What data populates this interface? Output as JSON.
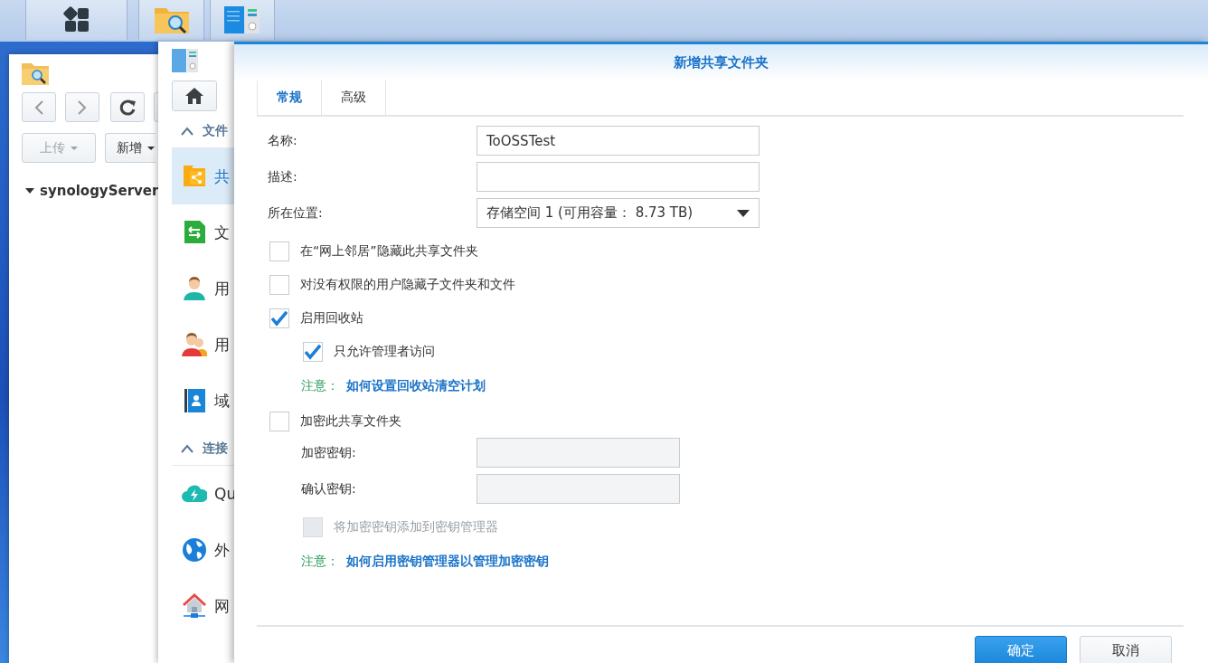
{
  "taskbar": {
    "buttons": [
      {
        "kind": "main-menu"
      },
      {
        "kind": "file-station"
      },
      {
        "kind": "control-panel"
      }
    ]
  },
  "file_station": {
    "nav": [
      {
        "kind": "back"
      },
      {
        "kind": "forward"
      },
      {
        "kind": "refresh"
      }
    ],
    "buttons": [
      {
        "label": "上传",
        "disabled": true
      },
      {
        "label": "新增",
        "disabled": false
      }
    ],
    "tree": [
      {
        "label": "synologyServer",
        "expanded": true
      }
    ]
  },
  "control_panel": {
    "sections": [
      {
        "title": "文件",
        "expanded": true,
        "items": [
          {
            "label": "共",
            "kind": "share",
            "selected": true
          },
          {
            "label": "文",
            "kind": "sync",
            "selected": false
          },
          {
            "label": "用",
            "kind": "user",
            "selected": false
          },
          {
            "label": "用",
            "kind": "group",
            "selected": false
          },
          {
            "label": "域",
            "kind": "directory",
            "selected": false
          }
        ]
      },
      {
        "title": "连接",
        "expanded": true,
        "items": [
          {
            "label": "Qu",
            "kind": "cloud",
            "selected": false
          },
          {
            "label": "外",
            "kind": "globe",
            "selected": false
          },
          {
            "label": "网",
            "kind": "network",
            "selected": false
          }
        ]
      }
    ]
  },
  "dialog": {
    "title": "新增共享文件夹",
    "tabs": [
      {
        "label": "常规",
        "selected": true
      },
      {
        "label": "高级",
        "selected": false
      }
    ],
    "fields": [
      {
        "label": "名称:",
        "kind": "text",
        "value": "ToOSSTest"
      },
      {
        "label": "描述:",
        "kind": "text"
      },
      {
        "label": "所在位置:",
        "kind": "select",
        "value": "存储空间 1 (可用容量： 8.73 TB)"
      }
    ],
    "options": [
      {
        "kind": "checkbox",
        "label": "在“网上邻居”隐藏此共享文件夹",
        "checked": false,
        "disabled": false
      },
      {
        "kind": "checkbox",
        "label": "对没有权限的用户隐藏子文件夹和文件",
        "checked": false,
        "disabled": false
      },
      {
        "kind": "checkbox",
        "label": "启用回收站",
        "checked": true,
        "disabled": false,
        "children": [
          {
            "kind": "checkbox",
            "label": "只允许管理者访问",
            "checked": true,
            "disabled": false
          },
          {
            "kind": "note",
            "label": "注意：",
            "link": "如何设置回收站清空计划"
          }
        ]
      },
      {
        "kind": "checkbox",
        "label": "加密此共享文件夹",
        "checked": false,
        "disabled": false,
        "children": [
          {
            "kind": "password",
            "label": "加密密钥:",
            "disabled": true
          },
          {
            "kind": "password",
            "label": "确认密钥:",
            "disabled": true
          },
          {
            "kind": "checkbox",
            "label": "将加密密钥添加到密钥管理器",
            "checked": false,
            "disabled": true
          },
          {
            "kind": "note",
            "label": "注意：",
            "link": "如何启用密钥管理器以管理加密密钥"
          }
        ]
      }
    ],
    "buttons": [
      {
        "label": "确定",
        "kind": "primary"
      },
      {
        "label": "取消",
        "kind": "secondary"
      }
    ]
  }
}
